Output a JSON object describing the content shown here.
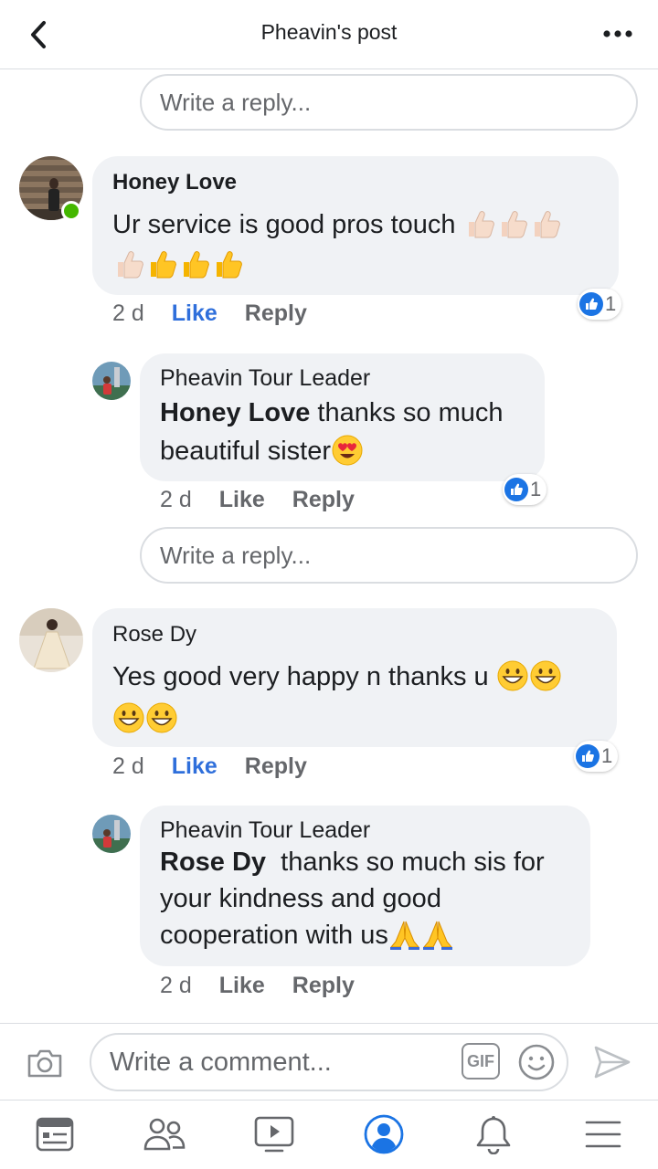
{
  "header": {
    "title": "Pheavin's post"
  },
  "reply_placeholder": "Write a reply...",
  "comments": [
    {
      "author": "Honey Love",
      "text": "Ur service is good pros touch",
      "time": "2 d",
      "like_label": "Like",
      "reply_label": "Reply",
      "reaction_count": "1",
      "liked": true,
      "emojis": [
        "thumbs-up-light",
        "thumbs-up-light",
        "thumbs-up-light",
        "thumbs-up-light",
        "thumbs-up-yellow",
        "thumbs-up-yellow",
        "thumbs-up-yellow"
      ]
    },
    {
      "author": "Pheavin Tour Leader",
      "mention": "Honey Love",
      "text": " thanks so much beautiful sister",
      "time": "2 d",
      "like_label": "Like",
      "reply_label": "Reply",
      "reaction_count": "1",
      "emojis": [
        "heart-eyes"
      ]
    },
    {
      "author": "Rose Dy",
      "text": "Yes good very happy n thanks u",
      "time": "2 d",
      "like_label": "Like",
      "reply_label": "Reply",
      "reaction_count": "1",
      "liked": true,
      "emojis": [
        "grinning",
        "grinning",
        "grinning",
        "grinning"
      ]
    },
    {
      "author": "Pheavin Tour Leader",
      "mention": "Rose Dy",
      "text": "  thanks so much sis for your kindness and good cooperation with us",
      "time": "2 d",
      "like_label": "Like",
      "reply_label": "Reply",
      "emojis": [
        "folded-hands",
        "folded-hands"
      ]
    }
  ],
  "comment_bar": {
    "placeholder": "Write a comment...",
    "gif_label": "GIF"
  },
  "colors": {
    "accent": "#1b74e4",
    "like_active": "#2f6fdb",
    "bubble": "#f0f2f5",
    "online": "#44b700"
  },
  "icons": [
    "back-chevron-icon",
    "more-dots-icon",
    "camera-icon",
    "gif-icon",
    "smiley-icon",
    "send-icon",
    "news-feed-icon",
    "friends-icon",
    "watch-icon",
    "profile-icon",
    "notifications-icon",
    "menu-icon"
  ]
}
